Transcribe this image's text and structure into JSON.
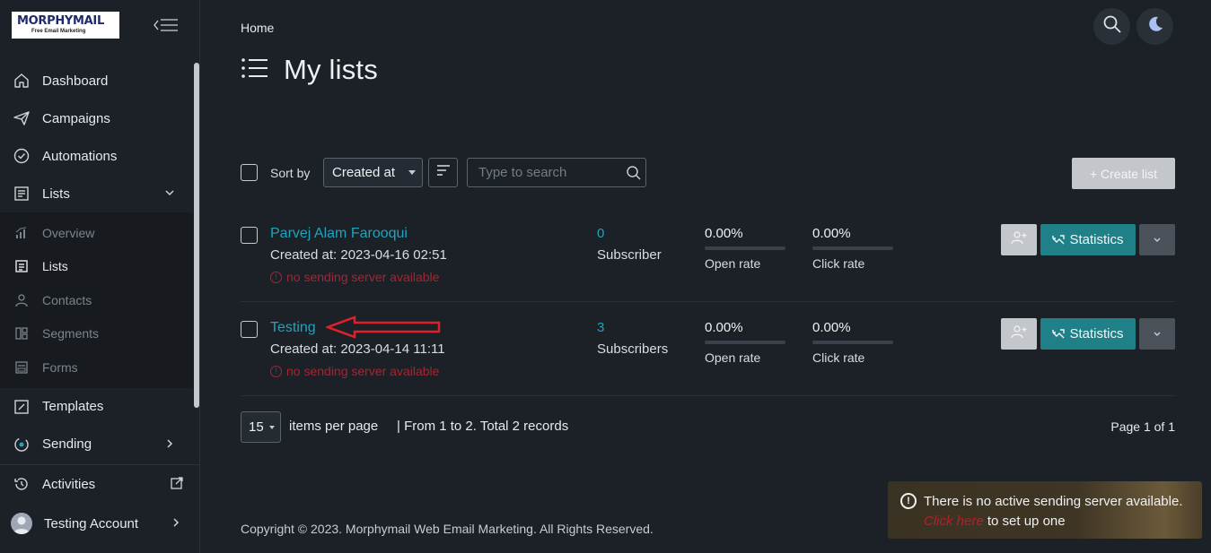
{
  "app": {
    "logo_text": "MORPHYMAIL",
    "logo_tagline": "Free Email Marketing"
  },
  "sidebar": {
    "items": [
      {
        "label": "Dashboard",
        "icon": "home-icon"
      },
      {
        "label": "Campaigns",
        "icon": "paper-plane-icon"
      },
      {
        "label": "Automations",
        "icon": "shield-check-icon"
      },
      {
        "label": "Lists",
        "icon": "list-icon",
        "expanded": true
      }
    ],
    "lists_sub": [
      {
        "label": "Overview",
        "icon": "bar-chart-icon"
      },
      {
        "label": "Lists",
        "icon": "list-box-icon",
        "active": true
      },
      {
        "label": "Contacts",
        "icon": "user-icon"
      },
      {
        "label": "Segments",
        "icon": "segments-icon"
      },
      {
        "label": "Forms",
        "icon": "form-icon"
      }
    ],
    "after": [
      {
        "label": "Templates",
        "icon": "template-icon"
      },
      {
        "label": "Sending",
        "icon": "sending-icon"
      }
    ],
    "bottom": [
      {
        "label": "Activities",
        "icon": "history-icon"
      },
      {
        "label": "Testing Account",
        "icon": "avatar"
      }
    ]
  },
  "header": {
    "breadcrumb": "Home",
    "title": "My lists"
  },
  "toolbar": {
    "sort_label": "Sort by",
    "sort_value": "Created at",
    "search_placeholder": "Type to search",
    "create_label": "+ Create list"
  },
  "lists": [
    {
      "name": "Parvej Alam Farooqui",
      "created": "Created at: 2023-04-16 02:51",
      "warning": "no sending server available",
      "count": "0",
      "count_label": "Subscriber",
      "open_rate": "0.00%",
      "open_rate_fraction": 0,
      "open_label": "Open rate",
      "click_rate": "0.00%",
      "click_rate_fraction": 0,
      "click_label": "Click rate",
      "stats_label": "Statistics"
    },
    {
      "name": "Testing",
      "created": "Created at: 2023-04-14 11:11",
      "warning": "no sending server available",
      "count": "3",
      "count_label": "Subscribers",
      "open_rate": "0.00%",
      "open_rate_fraction": 0,
      "open_label": "Open rate",
      "click_rate": "0.00%",
      "click_rate_fraction": 0,
      "click_label": "Click rate",
      "stats_label": "Statistics"
    }
  ],
  "pagination": {
    "per_page": "15",
    "per_page_label": "items per page",
    "records": "| From 1 to 2. Total 2 records",
    "page_info": "Page 1 of 1"
  },
  "footer": {
    "copyright": "Copyright © 2023. Morphymail Web Email Marketing. All Rights Reserved."
  },
  "toast": {
    "text_before": "There is no active sending server available.",
    "link_text": "Click here",
    "text_after": "to set up one"
  },
  "colors": {
    "accent": "#20a3bf",
    "primary_button": "#1f8087",
    "warning": "#a32633",
    "annotation_arrow": "#e0202a"
  }
}
